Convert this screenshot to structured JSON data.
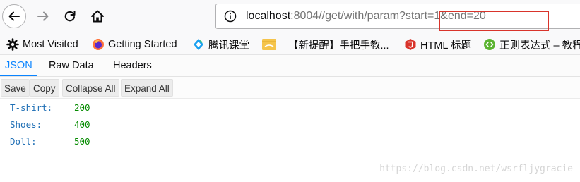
{
  "browser": {
    "url_host": "localhost",
    "url_rest": ":8004//get/with/param?start=1&end=20"
  },
  "bookmarks": [
    {
      "label": "Most Visited",
      "icon": "gear-icon"
    },
    {
      "label": "Getting Started",
      "icon": "firefox-icon"
    },
    {
      "label": "腾讯课堂",
      "icon": "tencent-class-icon"
    },
    {
      "label": "",
      "icon": "folder-bookmark-icon"
    },
    {
      "label": "【新提醒】手把手教...",
      "icon": ""
    },
    {
      "label": "HTML 标题",
      "icon": "html-icon"
    },
    {
      "label": "正则表达式 – 教程",
      "icon": "regex-icon"
    }
  ],
  "viewer": {
    "tabs": [
      "JSON",
      "Raw Data",
      "Headers"
    ],
    "active_tab": "JSON",
    "toolbar": [
      "Save",
      "Copy",
      "Collapse All",
      "Expand All"
    ]
  },
  "json": [
    {
      "key": "T-shirt:",
      "value": "200"
    },
    {
      "key": "Shoes:",
      "value": "400"
    },
    {
      "key": "Doll:",
      "value": "500"
    }
  ],
  "colors": {
    "active_tab": "#0a84ff",
    "json_key": "#1f6fb5",
    "json_value": "#058b00",
    "highlight": "#d9342b"
  },
  "watermark": "https://blog.csdn.net/wsrfljygracie"
}
